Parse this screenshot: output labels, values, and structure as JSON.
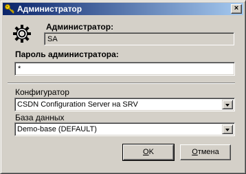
{
  "window": {
    "title": "Администратор",
    "close_label": "×"
  },
  "admin": {
    "label": "Администратор:",
    "value": "SA"
  },
  "password": {
    "label": "Пароль администратора:",
    "value": "*"
  },
  "configurator": {
    "label": "Конфигуратор",
    "selected": "CSDN Configuration Server на SRV"
  },
  "database": {
    "label": "База данных",
    "selected": "Demo-base (DEFAULT)"
  },
  "buttons": {
    "ok_mnemonic": "О",
    "ok_rest": "K",
    "cancel_mnemonic": "О",
    "cancel_rest": "тмена"
  },
  "icons": {
    "title": "key-icon",
    "admin": "gear-icon"
  }
}
